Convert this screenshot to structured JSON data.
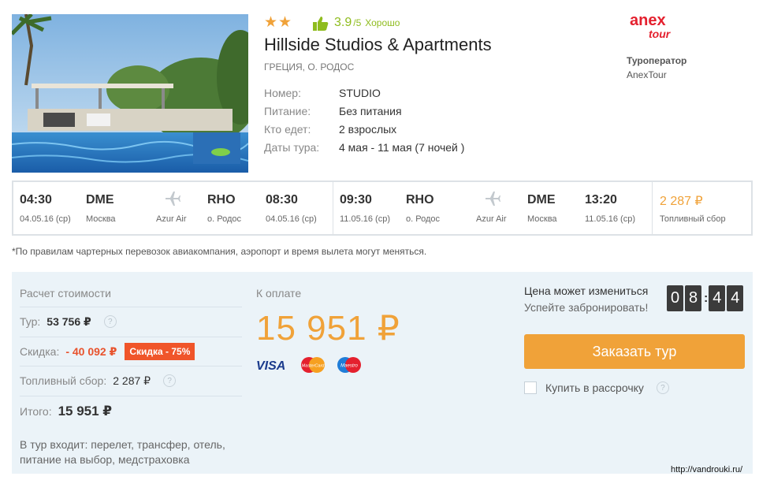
{
  "hotel": {
    "stars": "★★",
    "rating_icon": "thumbs-up-icon",
    "rating_score": "3.9",
    "rating_max": "/5",
    "rating_word": "Хорошо",
    "name": "Hillside Studios & Apartments",
    "location": "ГРЕЦИЯ, О. РОДОС",
    "details": [
      {
        "label": "Номер:",
        "value": "STUDIO"
      },
      {
        "label": "Питание:",
        "value": "Без питания"
      },
      {
        "label": "Кто едет:",
        "value": "2 взрослых"
      },
      {
        "label": "Даты тура:",
        "value": "4 мая - 11 мая (7 ночей )"
      }
    ]
  },
  "operator": {
    "logo_line1": "anex",
    "logo_line2": "tour",
    "title": "Туроператор",
    "name": "AnexTour"
  },
  "flights": {
    "outbound": {
      "dep_time": "04:30",
      "dep_date": "04.05.16 (ср)",
      "dep_code": "DME",
      "dep_city": "Москва",
      "airline": "Azur Air",
      "arr_code": "RHO",
      "arr_city": "о. Родос",
      "arr_time": "08:30",
      "arr_date": "04.05.16 (ср)"
    },
    "return": {
      "dep_time": "09:30",
      "dep_date": "11.05.16 (ср)",
      "dep_code": "RHO",
      "dep_city": "о. Родос",
      "airline": "Azur Air",
      "arr_code": "DME",
      "arr_city": "Москва",
      "arr_time": "13:20",
      "arr_date": "11.05.16 (ср)"
    },
    "fuel_price": "2 287 ₽",
    "fuel_label": "Топливный сбор"
  },
  "charter_note": "*По правилам чартерных перевозок авиакомпания, аэропорт и время вылета могут меняться.",
  "calc": {
    "title": "Расчет стоимости",
    "tour_label": "Тур:",
    "tour_value": "53 756 ₽",
    "discount_label": "Скидка:",
    "discount_value": "- 40 092 ₽",
    "discount_badge": "Скидка - 75%",
    "fuel_label": "Топливный сбор:",
    "fuel_value": "2 287 ₽",
    "total_label": "Итого:",
    "total_value": "15 951 ₽",
    "includes": "В тур входит: перелет, трансфер, отель, питание на выбор, медстраховка"
  },
  "payment": {
    "title": "К оплате",
    "amount": "15 951 ₽",
    "cards": [
      "VISA",
      "MasterCard",
      "Maestro"
    ]
  },
  "booking": {
    "warn_line1": "Цена может измениться",
    "warn_line2": "Успейте забронировать!",
    "timer_digits": [
      "0",
      "8",
      "4",
      "4"
    ],
    "button_label": "Заказать тур",
    "installment_label": "Купить в рассрочку"
  },
  "colors": {
    "accent": "#f0a239",
    "discount": "#f0552a",
    "rating": "#8fbc1e",
    "panel_bg": "#ebf3f8"
  },
  "watermark": "http://vandrouki.ru/"
}
